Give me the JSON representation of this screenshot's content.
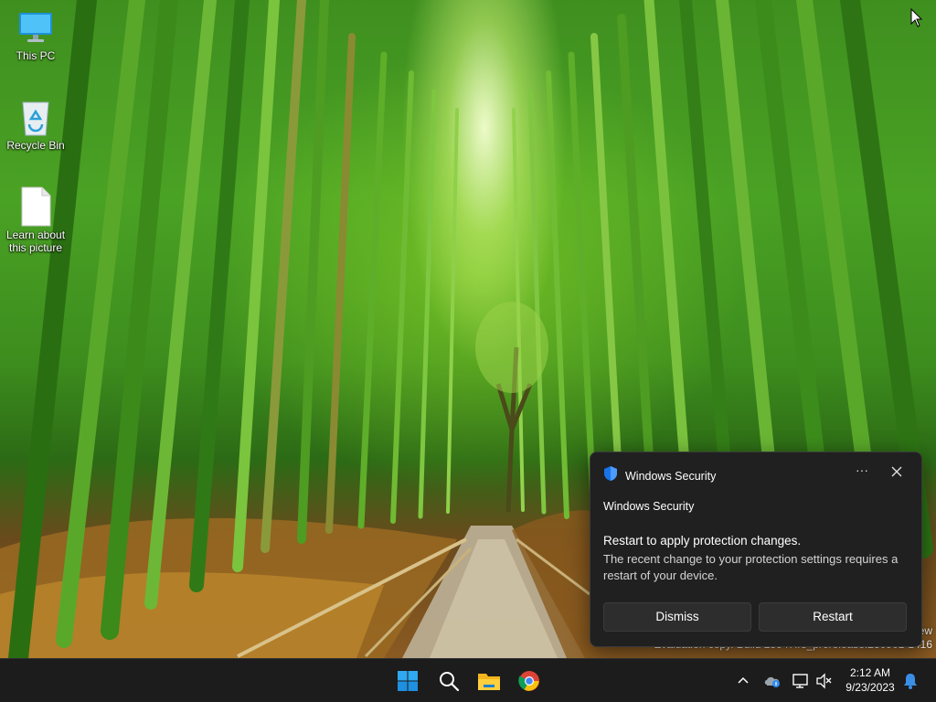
{
  "desktop": {
    "icons": [
      {
        "label": "This PC",
        "icon": "this-pc-icon"
      },
      {
        "label": "Recycle Bin",
        "icon": "recycle-bin-icon"
      },
      {
        "label": "Learn about\nthis picture",
        "icon": "document-icon"
      }
    ],
    "watermark": "ew\nEvaluation copy. Build 25947.rs_prerelease.230901-1416"
  },
  "toast": {
    "app_name": "Windows Security",
    "more_label": "···",
    "subtitle": "Windows Security",
    "title": "Restart to apply protection changes.",
    "body": "The recent change to your protection settings requires a restart of your device.",
    "dismiss_label": "Dismiss",
    "restart_label": "Restart"
  },
  "taskbar": {
    "pinned": [
      "start-icon",
      "search-icon",
      "file-explorer-icon",
      "chrome-icon"
    ],
    "tray": [
      "chevron-up-icon",
      "onedrive-icon",
      "network-icon",
      "volume-muted-icon",
      "notification-bell-icon"
    ],
    "clock": {
      "time": "2:12 AM",
      "date": "9/23/2023"
    }
  },
  "colors": {
    "toast_bg": "#202020",
    "taskbar_bg": "#1c1c1c",
    "accent": "#0078d4",
    "shield_blue": "#1a73e8"
  }
}
